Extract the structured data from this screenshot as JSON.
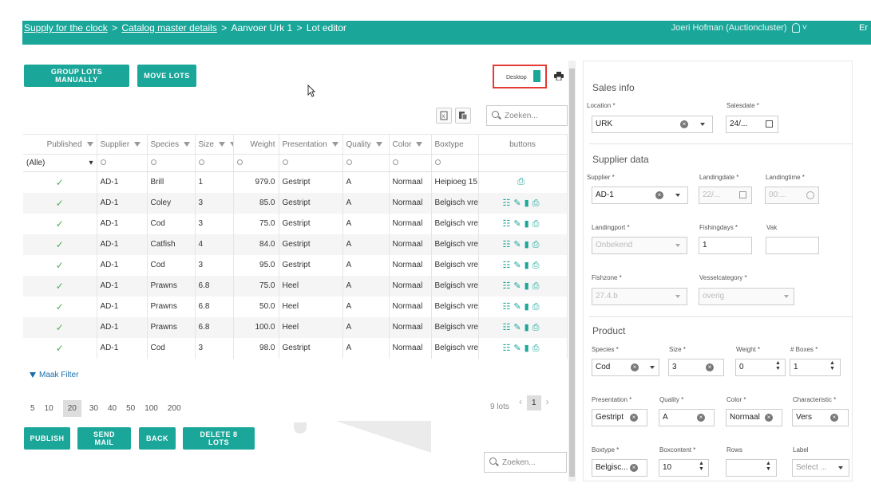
{
  "breadcrumb": {
    "items": [
      "Supply for the clock",
      "Catalog master details",
      "Aanvoer Urk 1",
      "Lot editor"
    ],
    "separator": ">"
  },
  "user": {
    "name": "Joeri Hofman (Auctioncluster)",
    "lang": "Er"
  },
  "toolbar": {
    "group_lots": "GROUP LOTS MANUALLY",
    "move_lots": "MOVE LOTS",
    "desktop": "Desktop"
  },
  "search": {
    "placeholder": "Zoeken..."
  },
  "grid": {
    "columns": [
      "Published",
      "Supplier",
      "Species",
      "Size",
      "Weight",
      "Presentation",
      "Quality",
      "Color",
      "Boxtype",
      "buttons"
    ],
    "filter_all": "(Alle)",
    "rows": [
      {
        "published": "✓",
        "supplier": "AD-1",
        "species": "Brill",
        "size": "1",
        "weight": "979.0",
        "presentation": "Gestript",
        "quality": "A",
        "color": "Normaal",
        "boxtype": "Heipioeg 15",
        "actions": "⎙"
      },
      {
        "published": "✓",
        "supplier": "AD-1",
        "species": "Coley",
        "size": "3",
        "weight": "85.0",
        "presentation": "Gestript",
        "quality": "A",
        "color": "Normaal",
        "boxtype": "Belgisch vree",
        "actions": "☷✎▮⎙"
      },
      {
        "published": "✓",
        "supplier": "AD-1",
        "species": "Cod",
        "size": "3",
        "weight": "75.0",
        "presentation": "Gestript",
        "quality": "A",
        "color": "Normaal",
        "boxtype": "Belgisch vree",
        "actions": "☷✎▮⎙"
      },
      {
        "published": "✓",
        "supplier": "AD-1",
        "species": "Catfish",
        "size": "4",
        "weight": "84.0",
        "presentation": "Gestript",
        "quality": "A",
        "color": "Normaal",
        "boxtype": "Belgisch vree",
        "actions": "☷✎▮⎙"
      },
      {
        "published": "✓",
        "supplier": "AD-1",
        "species": "Cod",
        "size": "3",
        "weight": "95.0",
        "presentation": "Gestript",
        "quality": "A",
        "color": "Normaal",
        "boxtype": "Belgisch vree",
        "actions": "☷✎▮⎙"
      },
      {
        "published": "✓",
        "supplier": "AD-1",
        "species": "Prawns",
        "size": "6.8",
        "weight": "75.0",
        "presentation": "Heel",
        "quality": "A",
        "color": "Normaal",
        "boxtype": "Belgisch vree",
        "actions": "☷✎▮⎙"
      },
      {
        "published": "✓",
        "supplier": "AD-1",
        "species": "Prawns",
        "size": "6.8",
        "weight": "50.0",
        "presentation": "Heel",
        "quality": "A",
        "color": "Normaal",
        "boxtype": "Belgisch vree",
        "actions": "☷✎▮⎙"
      },
      {
        "published": "✓",
        "supplier": "AD-1",
        "species": "Prawns",
        "size": "6.8",
        "weight": "100.0",
        "presentation": "Heel",
        "quality": "A",
        "color": "Normaal",
        "boxtype": "Belgisch vree",
        "actions": "☷✎▮⎙"
      },
      {
        "published": "✓",
        "supplier": "AD-1",
        "species": "Cod",
        "size": "3",
        "weight": "98.0",
        "presentation": "Gestript",
        "quality": "A",
        "color": "Normaal",
        "boxtype": "Belgisch vree",
        "actions": "☷✎▮⎙"
      }
    ]
  },
  "filter_link": "Maak Filter",
  "pager": {
    "sizes": [
      "5",
      "10",
      "20",
      "30",
      "40",
      "50",
      "100",
      "200"
    ],
    "selected": "20",
    "count": "9 lots",
    "page": "1"
  },
  "actions": {
    "publish": "PUBLISH",
    "send_mail": "SEND MAIL",
    "back": "BACK",
    "delete": "DELETE 8 LOTS"
  },
  "form": {
    "sales_info": "Sales info",
    "location_label": "Location *",
    "location": "URK",
    "salesdate_label": "Salesdate *",
    "salesdate": "24/...",
    "supplier_data": "Supplier data",
    "supplier_label": "Supplier *",
    "supplier": "AD-1",
    "landingdate_label": "Landingdate *",
    "landingdate": "22/...",
    "landingtime_label": "Landingtime *",
    "landingtime": "00:...",
    "landingport_label": "Landingport *",
    "landingport": "Onbekend",
    "fishingdays_label": "Fishingdays *",
    "fishingdays": "1",
    "vak_label": "Vak",
    "fishzone_label": "Fishzone *",
    "fishzone": "27.4.b",
    "vesselcategory_label": "Vesselcategory *",
    "vesselcategory": "overig",
    "product": "Product",
    "species_label": "Species *",
    "species": "Cod",
    "size_label": "Size *",
    "size": "3",
    "weight_label": "Weight *",
    "weight": "0",
    "boxes_label": "# Boxes *",
    "boxes": "1",
    "presentation_label": "Presentation *",
    "presentation": "Gestript",
    "quality_label": "Quality *",
    "quality": "A",
    "color_label": "Color *",
    "color": "Normaal",
    "characteristic_label": "Characteristic *",
    "characteristic": "Vers",
    "boxtype_label": "Boxtype *",
    "boxtype": "Belgisc...",
    "boxcontent_label": "Boxcontent *",
    "boxcontent": "10",
    "rows_label": "Rows",
    "label_label": "Label",
    "label_placeholder": "Select ..."
  },
  "colors": {
    "accent": "#1aa79a",
    "highlight": "#e53935"
  }
}
